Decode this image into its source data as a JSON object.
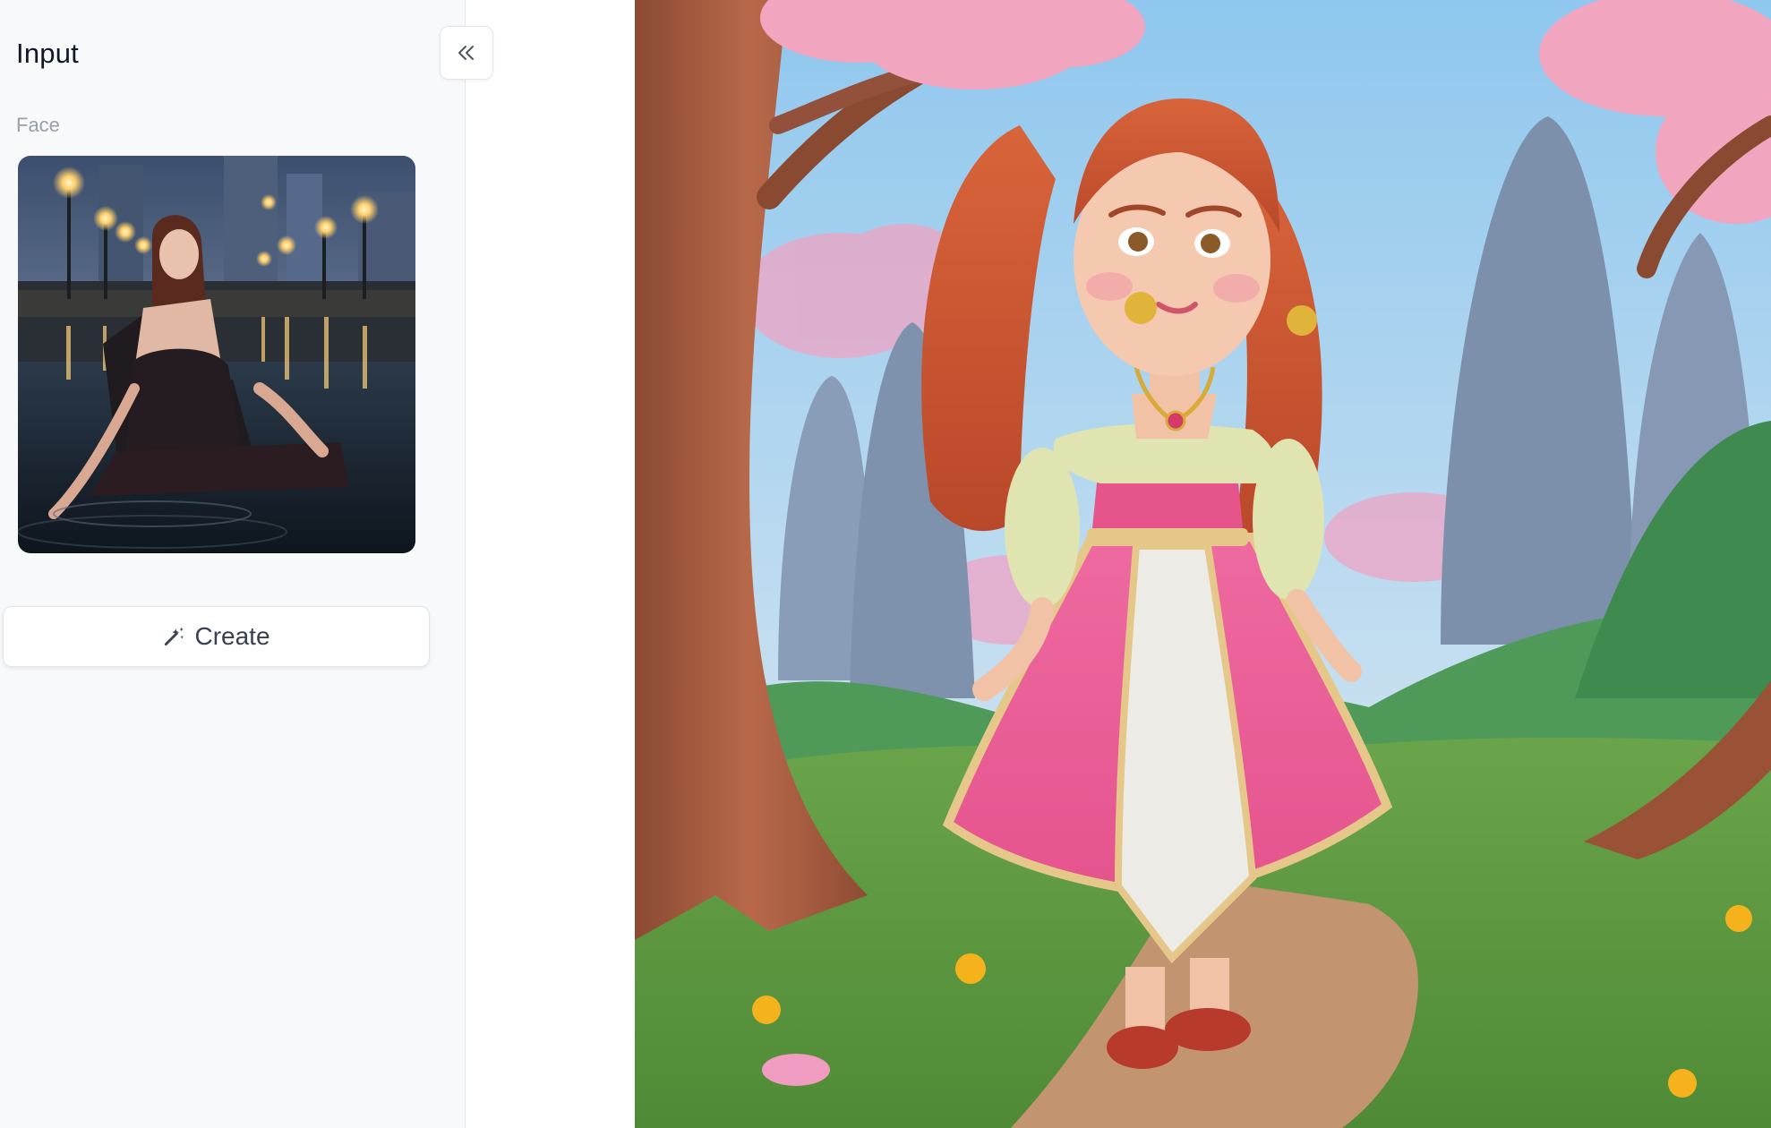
{
  "sidebar": {
    "title": "Input",
    "collapse_icon": "double-chevron-left-icon",
    "face_label": "Face",
    "face_image": "portrait of a woman sitting in water at night",
    "create_label": "Create",
    "create_icon": "magic-wand-icon"
  },
  "result": {
    "image": "3D cartoon princess in pink dress under pink trees"
  },
  "colors": {
    "sidebar_bg": "#f8f9fb",
    "border": "#e3e5e9",
    "title": "#111827",
    "muted_label": "#9aa0aa",
    "button_text": "#374151"
  }
}
